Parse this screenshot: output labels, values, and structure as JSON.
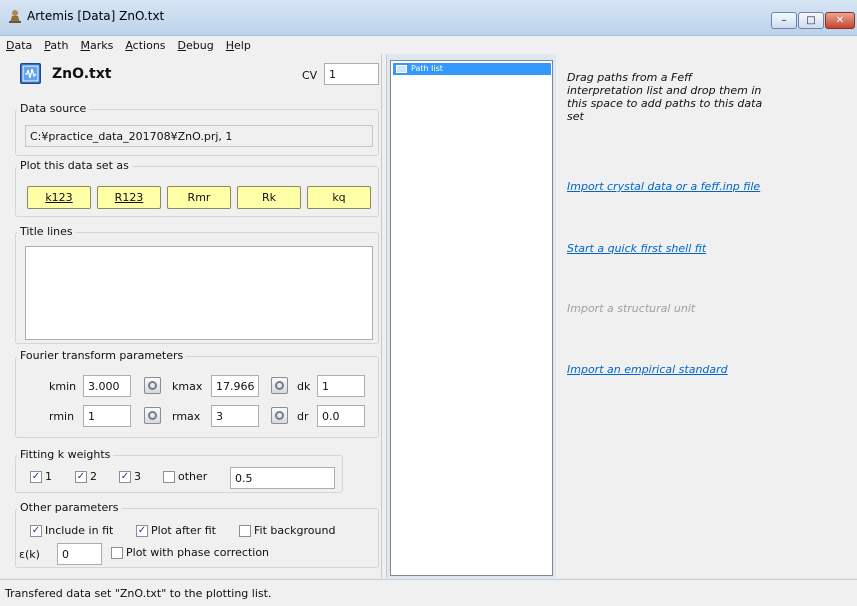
{
  "window": {
    "title": "Artemis [Data] ZnO.txt",
    "minimize_glyph": "–",
    "maximize_glyph": "□",
    "close_glyph": "✕"
  },
  "menu": [
    "Data",
    "Path",
    "Marks",
    "Actions",
    "Debug",
    "Help"
  ],
  "menu_accel": [
    "D",
    "P",
    "M",
    "A",
    "D",
    "H"
  ],
  "dataset": {
    "name": "ZnO.txt",
    "cv_label": "CV",
    "cv_value": "1"
  },
  "data_source": {
    "label": "Data source",
    "value": "C:¥practice_data_201708¥ZnO.prj, 1"
  },
  "plot": {
    "label": "Plot this data set as",
    "buttons": [
      "k123",
      "R123",
      "Rmr",
      "Rk",
      "kq"
    ],
    "color": "#ffffa8"
  },
  "title_lines": {
    "label": "Title lines",
    "value": ""
  },
  "fourier": {
    "label": "Fourier transform parameters",
    "kmin_label": "kmin",
    "kmin": "3.000",
    "kmax_label": "kmax",
    "kmax": "17.966",
    "dk_label": "dk",
    "dk": "1",
    "rmin_label": "rmin",
    "rmin": "1",
    "rmax_label": "rmax",
    "rmax": "3",
    "dr_label": "dr",
    "dr": "0.0"
  },
  "kweights": {
    "label": "Fitting k weights",
    "k1": "1",
    "k2": "2",
    "k3": "3",
    "other_label": "other",
    "other_value": "0.5",
    "checked": [
      true,
      true,
      true,
      false
    ]
  },
  "other_params": {
    "label": "Other parameters",
    "include_in_fit": "Include in fit",
    "plot_after_fit": "Plot after fit",
    "fit_background": "Fit background",
    "epsilon_label": "ε(k)",
    "epsilon_value": "0",
    "phase_correction": "Plot with phase correction",
    "checked": [
      true,
      true,
      false,
      false
    ]
  },
  "path_list": {
    "header": "Path list"
  },
  "right": {
    "drag_hint": "Drag paths from a Feff interpretation list and drop them in this space to add paths to this data set",
    "import_crystal": "Import crystal data or a feff.inp file",
    "quick_first_shell": "Start a quick first shell fit",
    "import_structural": "Import a structural unit",
    "import_empirical": "Import an empirical standard",
    "link_color": "#0066cc",
    "disabled_color": "#a0a0a0"
  },
  "status": "Transfered data set \"ZnO.txt\" to the plotting list."
}
